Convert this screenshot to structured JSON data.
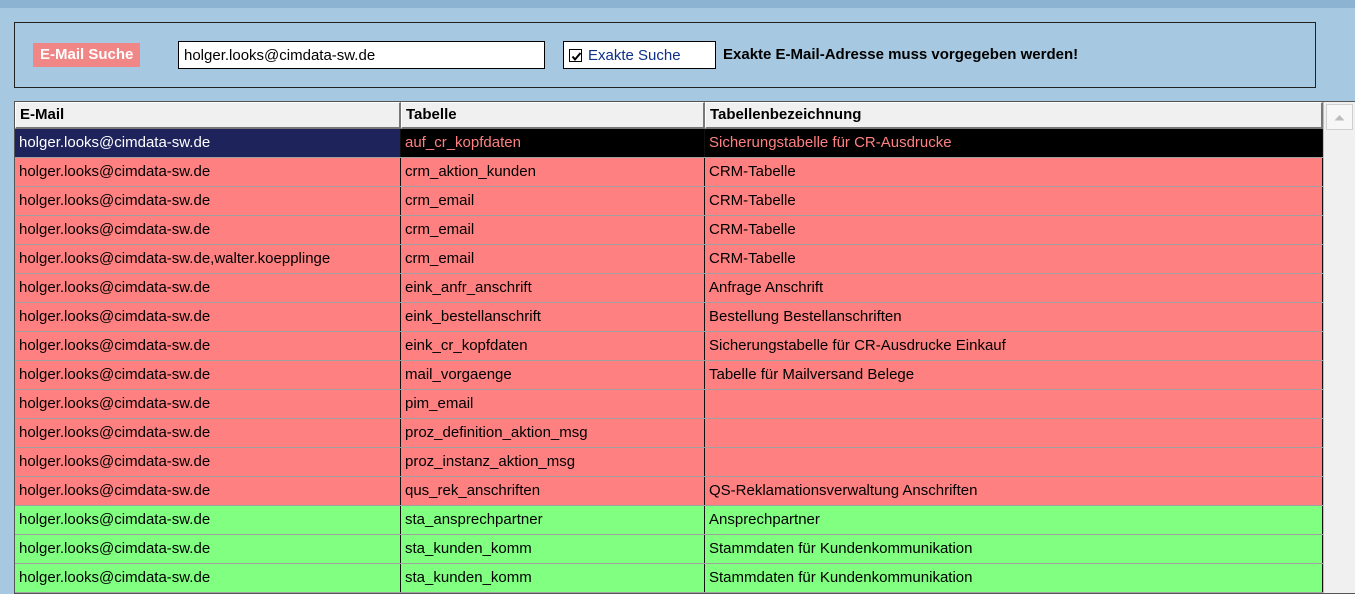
{
  "search": {
    "label": "E-Mail Suche",
    "value": "holger.looks@cimdata-sw.de",
    "exact_label": "Exakte Suche",
    "exact_checked": true,
    "hint": "Exakte E-Mail-Adresse muss vorgegeben werden!"
  },
  "table": {
    "columns": [
      "E-Mail",
      "Tabelle",
      "Tabellenbezeichnung"
    ],
    "rows": [
      {
        "email": "holger.looks@cimdata-sw.de",
        "tabelle": "auf_cr_kopfdaten",
        "bez": "Sicherungstabelle für CR-Ausdrucke",
        "status": "selected"
      },
      {
        "email": "holger.looks@cimdata-sw.de",
        "tabelle": "crm_aktion_kunden",
        "bez": "CRM-Tabelle",
        "status": "red"
      },
      {
        "email": "holger.looks@cimdata-sw.de",
        "tabelle": "crm_email",
        "bez": "CRM-Tabelle",
        "status": "red"
      },
      {
        "email": "holger.looks@cimdata-sw.de",
        "tabelle": "crm_email",
        "bez": "CRM-Tabelle",
        "status": "red"
      },
      {
        "email": "holger.looks@cimdata-sw.de,walter.koepplinge",
        "tabelle": "crm_email",
        "bez": "CRM-Tabelle",
        "status": "red"
      },
      {
        "email": "holger.looks@cimdata-sw.de",
        "tabelle": "eink_anfr_anschrift",
        "bez": "Anfrage Anschrift",
        "status": "red"
      },
      {
        "email": "holger.looks@cimdata-sw.de",
        "tabelle": "eink_bestellanschrift",
        "bez": "Bestellung Bestellanschriften",
        "status": "red"
      },
      {
        "email": "holger.looks@cimdata-sw.de",
        "tabelle": "eink_cr_kopfdaten",
        "bez": "Sicherungstabelle für CR-Ausdrucke Einkauf",
        "status": "red"
      },
      {
        "email": "holger.looks@cimdata-sw.de",
        "tabelle": "mail_vorgaenge",
        "bez": "Tabelle für Mailversand Belege",
        "status": "red"
      },
      {
        "email": "holger.looks@cimdata-sw.de",
        "tabelle": "pim_email",
        "bez": "",
        "status": "red"
      },
      {
        "email": "holger.looks@cimdata-sw.de",
        "tabelle": "proz_definition_aktion_msg",
        "bez": "",
        "status": "red"
      },
      {
        "email": "holger.looks@cimdata-sw.de",
        "tabelle": "proz_instanz_aktion_msg",
        "bez": "",
        "status": "red"
      },
      {
        "email": "holger.looks@cimdata-sw.de",
        "tabelle": "qus_rek_anschriften",
        "bez": "QS-Reklamationsverwaltung Anschriften",
        "status": "red"
      },
      {
        "email": "holger.looks@cimdata-sw.de",
        "tabelle": "sta_ansprechpartner",
        "bez": "Ansprechpartner",
        "status": "green"
      },
      {
        "email": "holger.looks@cimdata-sw.de",
        "tabelle": "sta_kunden_komm",
        "bez": "Stammdaten für Kundenkommunikation",
        "status": "green"
      },
      {
        "email": "holger.looks@cimdata-sw.de",
        "tabelle": "sta_kunden_komm",
        "bez": "Stammdaten für Kundenkommunikation",
        "status": "green"
      }
    ]
  },
  "colors": {
    "background": "#a6c8e0",
    "red_row": "#ff8080",
    "green_row": "#80ff80",
    "selected_row": "#000000",
    "selected_email_cell": "#1e235c",
    "label_bg": "#f08686"
  },
  "icons": {
    "check": "check-icon",
    "scroll_up": "arrow-up-icon"
  }
}
